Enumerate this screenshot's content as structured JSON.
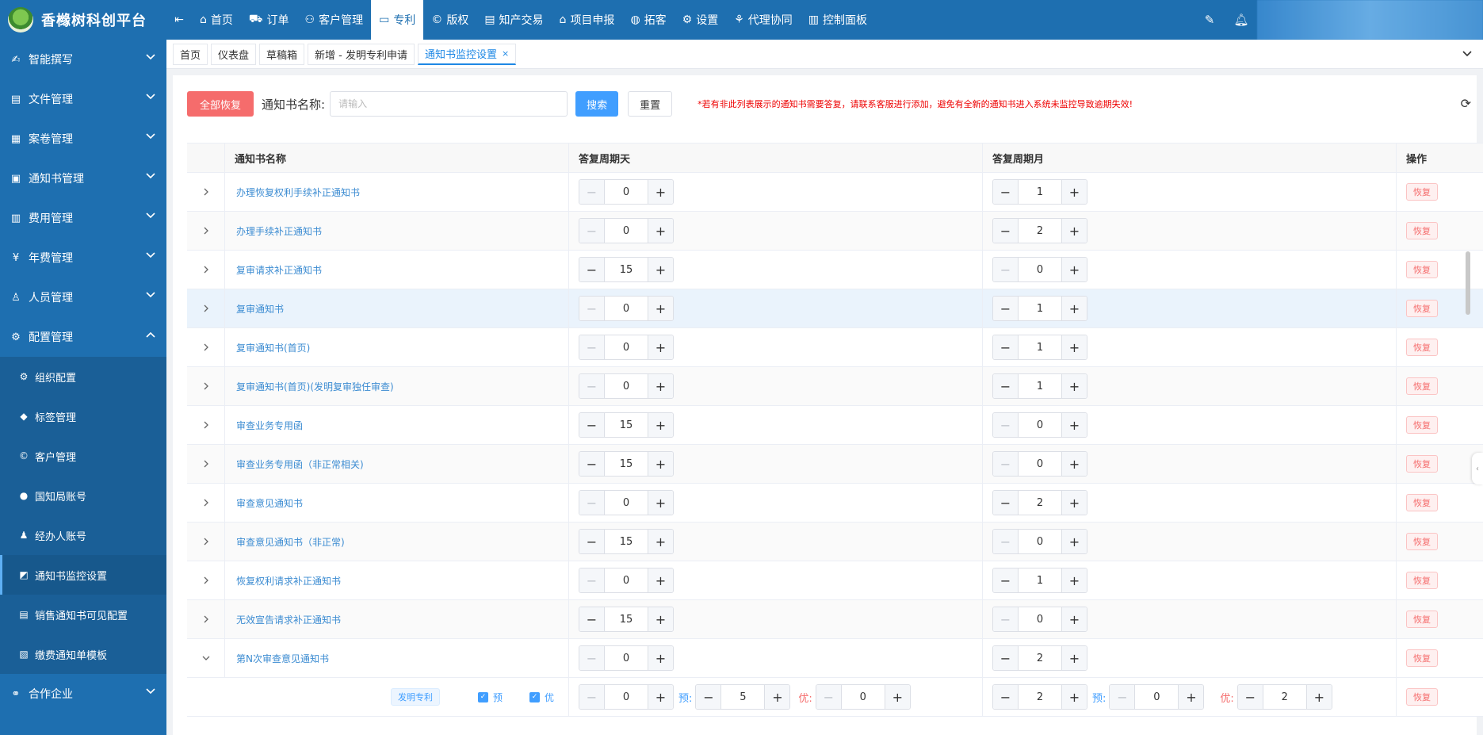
{
  "app": {
    "title": "香橼树科创平台"
  },
  "sidebar": {
    "items": [
      {
        "label": "智能撰写",
        "icon": "pen-person-icon"
      },
      {
        "label": "文件管理",
        "icon": "file-list-icon"
      },
      {
        "label": "案卷管理",
        "icon": "folder-case-icon"
      },
      {
        "label": "通知书管理",
        "icon": "pdf-icon"
      },
      {
        "label": "费用管理",
        "icon": "fee-icon"
      },
      {
        "label": "年费管理",
        "icon": "yen-coin-icon"
      },
      {
        "label": "人员管理",
        "icon": "user-icon"
      },
      {
        "label": "配置管理",
        "icon": "gear-icon"
      }
    ],
    "subitems": [
      {
        "label": "组织配置",
        "icon": "gears-icon"
      },
      {
        "label": "标签管理",
        "icon": "tag-icon"
      },
      {
        "label": "客户管理",
        "icon": "c-circle-icon"
      },
      {
        "label": "国知局账号",
        "icon": "user-small-icon"
      },
      {
        "label": "经办人账号",
        "icon": "person-icon"
      },
      {
        "label": "通知书监控设置",
        "icon": "monitor-settings-icon"
      },
      {
        "label": "销售通知书可见配置",
        "icon": "doc-list-icon"
      },
      {
        "label": "缴费通知单模板",
        "icon": "template-icon"
      }
    ],
    "last_item": {
      "label": "合作企业",
      "icon": "handshake-icon"
    }
  },
  "topnav": {
    "items": [
      {
        "label": "首页",
        "icon": "home-icon"
      },
      {
        "label": "订单",
        "icon": "cart-icon"
      },
      {
        "label": "客户管理",
        "icon": "customers-icon"
      },
      {
        "label": "专利",
        "icon": "monitor-icon"
      },
      {
        "label": "版权",
        "icon": "copyright-icon"
      },
      {
        "label": "知产交易",
        "icon": "document-icon"
      },
      {
        "label": "项目申报",
        "icon": "building-icon"
      },
      {
        "label": "拓客",
        "icon": "globe-icon"
      },
      {
        "label": "设置",
        "icon": "gear-icon"
      },
      {
        "label": "代理协同",
        "icon": "collab-icon"
      },
      {
        "label": "控制面板",
        "icon": "panel-icon"
      }
    ],
    "active_index": 3
  },
  "tabs": {
    "items": [
      "首页",
      "仪表盘",
      "草稿箱",
      "新增 - 发明专利申请",
      "通知书监控设置"
    ],
    "close_label": "×"
  },
  "toolbar": {
    "restore_all": "全部恢复",
    "name_label": "通知书名称:",
    "search_placeholder": "请输入",
    "search_button": "搜索",
    "reset_button": "重置",
    "warning": "*若有非此列表展示的通知书需要答复，请联系客服进行添加，避免有全新的通知书进入系统未监控导致逾期失效!"
  },
  "table": {
    "headers": {
      "name": "通知书名称",
      "day": "答复周期天",
      "month": "答复周期月",
      "op": "操作"
    },
    "rows": [
      {
        "name": "办理恢复权利手续补正通知书",
        "day": "0",
        "month": "1"
      },
      {
        "name": "办理手续补正通知书",
        "day": "0",
        "month": "2"
      },
      {
        "name": "复审请求补正通知书",
        "day": "15",
        "month": "0"
      },
      {
        "name": "复审通知书",
        "day": "0",
        "month": "1"
      },
      {
        "name": "复审通知书(首页)",
        "day": "0",
        "month": "1"
      },
      {
        "name": "复审通知书(首页)(发明复审独任审查)",
        "day": "0",
        "month": "1"
      },
      {
        "name": "审查业务专用函",
        "day": "15",
        "month": "0"
      },
      {
        "name": "审查业务专用函（非正常相关)",
        "day": "15",
        "month": "0"
      },
      {
        "name": "审查意见通知书",
        "day": "0",
        "month": "2"
      },
      {
        "name": "审查意见通知书（非正常)",
        "day": "15",
        "month": "0"
      },
      {
        "name": "恢复权利请求补正通知书",
        "day": "0",
        "month": "1"
      },
      {
        "name": "无效宣告请求补正通知书",
        "day": "15",
        "month": "0"
      },
      {
        "name": "第N次审查意见通知书",
        "day": "0",
        "month": "2"
      }
    ],
    "restore_label": "恢复",
    "sub_row": {
      "tag": "发明专利",
      "check_pre": "预",
      "check_pri": "优",
      "day": "0",
      "day_pre_label": "预:",
      "day_pre": "5",
      "day_pri_label": "优:",
      "day_pri": "0",
      "month": "2",
      "month_pre_label": "预:",
      "month_pre": "0",
      "month_pri_label": "优:",
      "month_pri": "2"
    }
  },
  "stepper": {
    "minus": "−",
    "plus": "+"
  },
  "colors": {
    "primary": "#1e6fb0",
    "link": "#3c8cd2",
    "danger": "#f56c6c",
    "accent": "#409eff"
  }
}
